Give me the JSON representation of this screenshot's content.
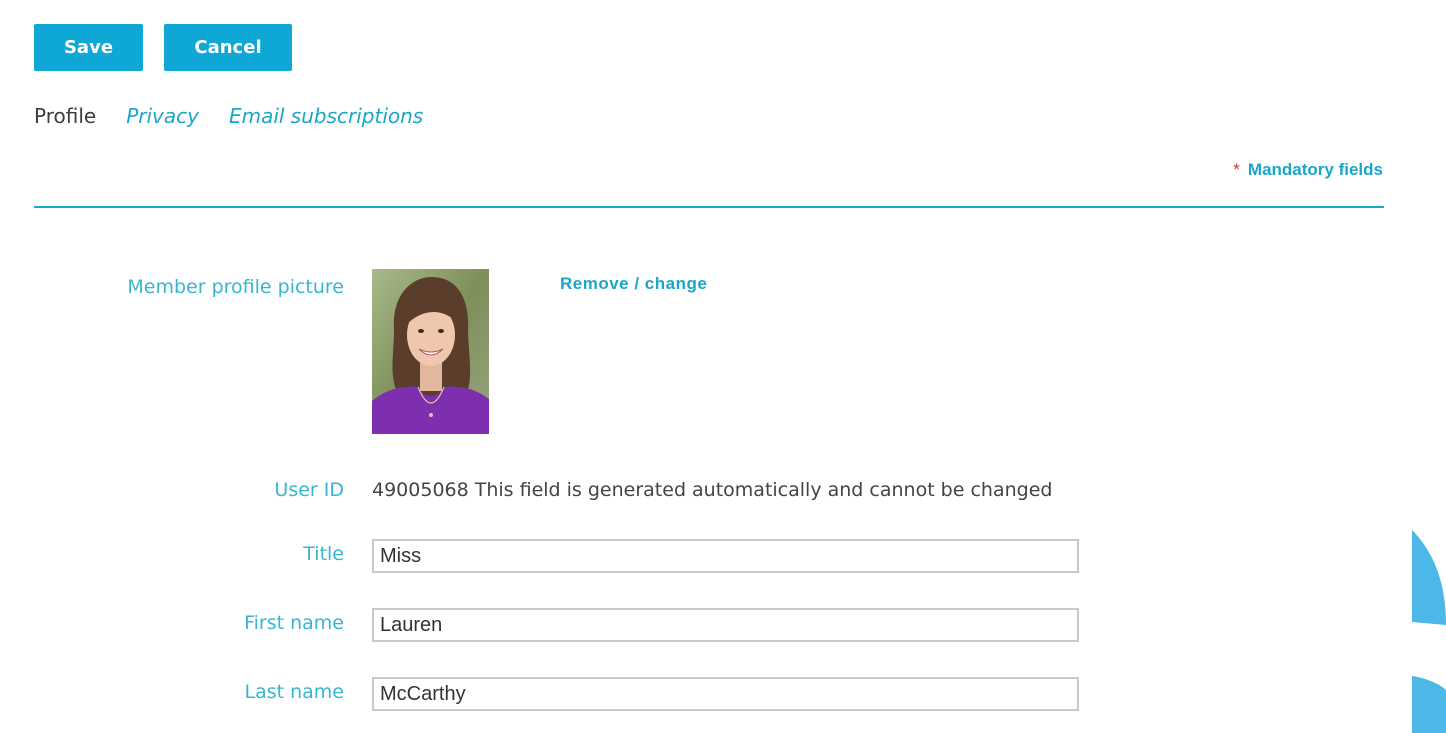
{
  "toolbar": {
    "save_label": "Save",
    "cancel_label": "Cancel"
  },
  "tabs": [
    {
      "label": "Profile",
      "active": true
    },
    {
      "label": "Privacy",
      "active": false
    },
    {
      "label": "Email subscriptions",
      "active": false
    }
  ],
  "mandatory": {
    "star": "*",
    "label": "Mandatory fields"
  },
  "profile": {
    "picture_label": "Member profile picture",
    "remove_change_label": "Remove / change",
    "user_id_label": "User ID",
    "user_id_value": "49005068 This field is generated automatically and cannot be changed",
    "title_label": "Title",
    "title_value": "Miss",
    "first_name_label": "First name",
    "first_name_value": "Lauren",
    "last_name_label": "Last name",
    "last_name_value": "McCarthy"
  },
  "colors": {
    "accent": "#0fa8d6",
    "link": "#1ba6c8",
    "label": "#38b6d0",
    "required_star": "#d32f2f"
  }
}
